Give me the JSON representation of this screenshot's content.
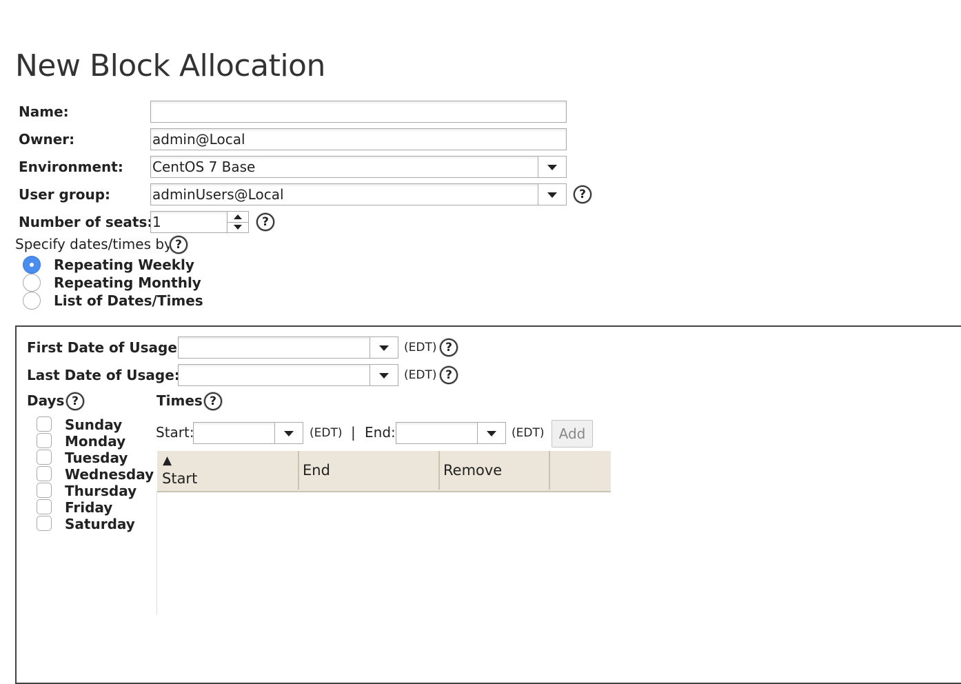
{
  "page": {
    "title": "New Block Allocation"
  },
  "form": {
    "name_label": "Name:",
    "name_value": "",
    "owner_label": "Owner:",
    "owner_value": "admin@Local",
    "environment_label": "Environment:",
    "environment_value": "CentOS 7 Base",
    "user_group_label": "User group:",
    "user_group_value": "adminUsers@Local",
    "seats_label": "Number of seats:",
    "seats_value": "1",
    "help_glyph": "?"
  },
  "specify": {
    "label": "Specify dates/times by:",
    "options": [
      {
        "label": "Repeating Weekly",
        "selected": true
      },
      {
        "label": "Repeating Monthly",
        "selected": false
      },
      {
        "label": "List of Dates/Times",
        "selected": false
      }
    ]
  },
  "weekly": {
    "first_date_label": "First Date of Usage:",
    "first_date_value": "",
    "last_date_label": "Last Date of Usage:",
    "last_date_value": "",
    "timezone": "(EDT)",
    "days_label": "Days",
    "days": [
      {
        "label": "Sunday",
        "checked": false
      },
      {
        "label": "Monday",
        "checked": false
      },
      {
        "label": "Tuesday",
        "checked": false
      },
      {
        "label": "Wednesday",
        "checked": false
      },
      {
        "label": "Thursday",
        "checked": false
      },
      {
        "label": "Friday",
        "checked": false
      },
      {
        "label": "Saturday",
        "checked": false
      }
    ],
    "times_label": "Times",
    "start_label": "Start:",
    "start_value": "",
    "separator": "|",
    "end_label": "End:",
    "end_value": "",
    "add_label": "Add",
    "table": {
      "sort_indicator": "▲",
      "columns": [
        "Start",
        "End",
        "Remove"
      ],
      "rows": []
    }
  },
  "colors": {
    "accent": "#4a8cf0",
    "table_header": "#ebe6d9"
  }
}
